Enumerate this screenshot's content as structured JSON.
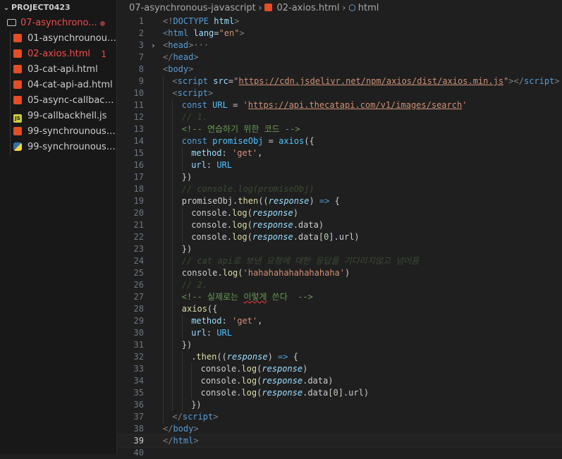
{
  "sidebar": {
    "project_title": "PROJECT0423",
    "folder": {
      "name": "07-asynchronous-javascript",
      "display": "07-asynchrono..."
    },
    "files": [
      {
        "name": "01-asynchrounous.h...",
        "type": "html",
        "active": false,
        "badge": ""
      },
      {
        "name": "02-axios.html",
        "type": "html",
        "active": true,
        "badge": "1"
      },
      {
        "name": "03-cat-api.html",
        "type": "html",
        "active": false,
        "badge": ""
      },
      {
        "name": "04-cat-api-ad.html",
        "type": "html",
        "active": false,
        "badge": ""
      },
      {
        "name": "05-async-callback.ht...",
        "type": "html",
        "active": false,
        "badge": ""
      },
      {
        "name": "99-callbackhell.js",
        "type": "js",
        "active": false,
        "badge": ""
      },
      {
        "name": "99-synchrounous.ht...",
        "type": "html",
        "active": false,
        "badge": ""
      },
      {
        "name": "99-synchrounous.py",
        "type": "py",
        "active": false,
        "badge": ""
      }
    ]
  },
  "breadcrumb": {
    "folder": "07-asynchronous-javascript",
    "file": "02-axios.html",
    "element": "html"
  },
  "editor": {
    "current_line": 39,
    "lines": [
      {
        "n": "1",
        "indent": 0,
        "parts": [
          [
            "p",
            "<!"
          ],
          [
            "t",
            "DOCTYPE"
          ],
          [
            "d",
            " "
          ],
          [
            "a",
            "html"
          ],
          [
            "p",
            ">"
          ]
        ]
      },
      {
        "n": "2",
        "indent": 0,
        "parts": [
          [
            "p",
            "<"
          ],
          [
            "t",
            "html"
          ],
          [
            "d",
            " "
          ],
          [
            "a",
            "lang"
          ],
          [
            "d",
            "="
          ],
          [
            "s",
            "\"en\""
          ],
          [
            "p",
            ">"
          ]
        ]
      },
      {
        "n": "3",
        "indent": 0,
        "fold": "›",
        "parts": [
          [
            "p",
            "<"
          ],
          [
            "t",
            "head"
          ],
          [
            "p",
            ">"
          ],
          [
            "e",
            "···"
          ]
        ]
      },
      {
        "n": "7",
        "indent": 0,
        "parts": [
          [
            "p",
            "</"
          ],
          [
            "t",
            "head"
          ],
          [
            "p",
            ">"
          ]
        ]
      },
      {
        "n": "8",
        "indent": 0,
        "parts": [
          [
            "p",
            "<"
          ],
          [
            "t",
            "body"
          ],
          [
            "p",
            ">"
          ]
        ]
      },
      {
        "n": "9",
        "indent": 1,
        "parts": [
          [
            "p",
            "<"
          ],
          [
            "t",
            "script"
          ],
          [
            "d",
            " "
          ],
          [
            "a",
            "src"
          ],
          [
            "d",
            "="
          ],
          [
            "s",
            "\""
          ],
          [
            "u",
            "https://cdn.jsdelivr.net/npm/axios/dist/axios.min.js"
          ],
          [
            "s",
            "\""
          ],
          [
            "p",
            "></"
          ],
          [
            "t",
            "script"
          ],
          [
            "p",
            ">"
          ]
        ]
      },
      {
        "n": "10",
        "indent": 1,
        "parts": [
          [
            "p",
            "<"
          ],
          [
            "t",
            "script"
          ],
          [
            "p",
            ">"
          ]
        ]
      },
      {
        "n": "11",
        "indent": 2,
        "parts": [
          [
            "k",
            "const"
          ],
          [
            "d",
            " "
          ],
          [
            "v",
            "URL"
          ],
          [
            "d",
            " = "
          ],
          [
            "s",
            "'"
          ],
          [
            "u",
            "https://api.thecatapi.com/v1/images/search"
          ],
          [
            "s",
            "'"
          ]
        ]
      },
      {
        "n": "12",
        "indent": 2,
        "parts": [
          [
            "c dim",
            "// 1."
          ]
        ]
      },
      {
        "n": "13",
        "indent": 2,
        "parts": [
          [
            "cm",
            "<!-- 연습하기 위한 코드 -->"
          ]
        ]
      },
      {
        "n": "14",
        "indent": 2,
        "parts": [
          [
            "k",
            "const"
          ],
          [
            "d",
            " "
          ],
          [
            "v",
            "promiseObj"
          ],
          [
            "d",
            " = "
          ],
          [
            "v",
            "axios"
          ],
          [
            "d",
            "({"
          ]
        ]
      },
      {
        "n": "15",
        "indent": 3,
        "parts": [
          [
            "pr",
            "method"
          ],
          [
            "d",
            ": "
          ],
          [
            "s",
            "'get'"
          ],
          [
            "d",
            ","
          ]
        ]
      },
      {
        "n": "16",
        "indent": 3,
        "parts": [
          [
            "pr",
            "url"
          ],
          [
            "d",
            ": "
          ],
          [
            "v",
            "URL"
          ]
        ]
      },
      {
        "n": "17",
        "indent": 2,
        "parts": [
          [
            "d",
            "})"
          ]
        ]
      },
      {
        "n": "18",
        "indent": 2,
        "parts": [
          [
            "c dim",
            "// console.log(promiseObj)"
          ]
        ]
      },
      {
        "n": "19",
        "indent": 2,
        "parts": [
          [
            "d",
            "promiseObj."
          ],
          [
            "f",
            "then"
          ],
          [
            "d",
            "(("
          ],
          [
            "pm",
            "response"
          ],
          [
            "d",
            ") "
          ],
          [
            "k",
            "=>"
          ],
          [
            "d",
            " {"
          ]
        ]
      },
      {
        "n": "20",
        "indent": 3,
        "parts": [
          [
            "d",
            "console."
          ],
          [
            "f",
            "log"
          ],
          [
            "d",
            "("
          ],
          [
            "pm",
            "response"
          ],
          [
            "d",
            ")"
          ]
        ]
      },
      {
        "n": "21",
        "indent": 3,
        "parts": [
          [
            "d",
            "console."
          ],
          [
            "f",
            "log"
          ],
          [
            "d",
            "("
          ],
          [
            "pm",
            "response"
          ],
          [
            "d",
            ".data)"
          ]
        ]
      },
      {
        "n": "22",
        "indent": 3,
        "parts": [
          [
            "d",
            "console."
          ],
          [
            "f",
            "log"
          ],
          [
            "d",
            "("
          ],
          [
            "pm",
            "response"
          ],
          [
            "d",
            ".data["
          ],
          [
            "n",
            "0"
          ],
          [
            "d",
            "].url)"
          ]
        ]
      },
      {
        "n": "23",
        "indent": 2,
        "parts": [
          [
            "d",
            "})"
          ]
        ]
      },
      {
        "n": "24",
        "indent": 2,
        "parts": [
          [
            "c dim",
            "// cat api로 보낸 요청에 대한 응답을 기다리지않고 넘어옴"
          ]
        ]
      },
      {
        "n": "25",
        "indent": 2,
        "parts": [
          [
            "d",
            "console."
          ],
          [
            "f",
            "log"
          ],
          [
            "d",
            "("
          ],
          [
            "s",
            "'hahahahahahahahaha'"
          ],
          [
            "d",
            ")"
          ]
        ]
      },
      {
        "n": "26",
        "indent": 2,
        "parts": [
          [
            "c dim",
            "// 2."
          ]
        ]
      },
      {
        "n": "27",
        "indent": 2,
        "parts": [
          [
            "cm",
            "<!-- 실제로는 "
          ],
          [
            "cm squig",
            "이렇게"
          ],
          [
            "cm",
            " 쓴다  -->"
          ]
        ]
      },
      {
        "n": "28",
        "indent": 2,
        "parts": [
          [
            "f",
            "axios"
          ],
          [
            "d",
            "({"
          ]
        ]
      },
      {
        "n": "29",
        "indent": 3,
        "parts": [
          [
            "pr",
            "method"
          ],
          [
            "d",
            ": "
          ],
          [
            "s",
            "'get'"
          ],
          [
            "d",
            ","
          ]
        ]
      },
      {
        "n": "30",
        "indent": 3,
        "parts": [
          [
            "pr",
            "url"
          ],
          [
            "d",
            ": "
          ],
          [
            "v",
            "URL"
          ]
        ]
      },
      {
        "n": "31",
        "indent": 2,
        "parts": [
          [
            "d",
            "})"
          ]
        ]
      },
      {
        "n": "32",
        "indent": 3,
        "parts": [
          [
            "d",
            "."
          ],
          [
            "f",
            "then"
          ],
          [
            "d",
            "(("
          ],
          [
            "pm",
            "response"
          ],
          [
            "d",
            ") "
          ],
          [
            "k",
            "=>"
          ],
          [
            "d",
            " {"
          ]
        ]
      },
      {
        "n": "33",
        "indent": 4,
        "parts": [
          [
            "d",
            "console."
          ],
          [
            "f",
            "log"
          ],
          [
            "d",
            "("
          ],
          [
            "pm",
            "response"
          ],
          [
            "d",
            ")"
          ]
        ]
      },
      {
        "n": "34",
        "indent": 4,
        "parts": [
          [
            "d",
            "console."
          ],
          [
            "f",
            "log"
          ],
          [
            "d",
            "("
          ],
          [
            "pm",
            "response"
          ],
          [
            "d",
            ".data)"
          ]
        ]
      },
      {
        "n": "35",
        "indent": 4,
        "parts": [
          [
            "d",
            "console."
          ],
          [
            "f",
            "log"
          ],
          [
            "d",
            "("
          ],
          [
            "pm",
            "response"
          ],
          [
            "d",
            ".data["
          ],
          [
            "n",
            "0"
          ],
          [
            "d",
            "].url)"
          ]
        ]
      },
      {
        "n": "36",
        "indent": 3,
        "parts": [
          [
            "d",
            "})"
          ]
        ]
      },
      {
        "n": "37",
        "indent": 1,
        "parts": [
          [
            "p",
            "</"
          ],
          [
            "t",
            "script"
          ],
          [
            "p",
            ">"
          ]
        ]
      },
      {
        "n": "38",
        "indent": 0,
        "parts": [
          [
            "p",
            "</"
          ],
          [
            "t",
            "body"
          ],
          [
            "p",
            ">"
          ]
        ]
      },
      {
        "n": "39",
        "indent": 0,
        "parts": [
          [
            "p",
            "</"
          ],
          [
            "t",
            "html"
          ],
          [
            "p",
            ">"
          ]
        ]
      },
      {
        "n": "40",
        "indent": 0,
        "parts": []
      }
    ]
  }
}
